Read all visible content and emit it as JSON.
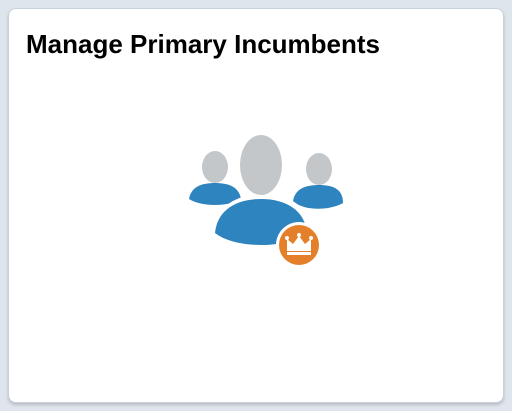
{
  "tile": {
    "title": "Manage Primary Incumbents",
    "icon": "people-group-crown-icon"
  },
  "colors": {
    "head_gray": "#c3c7ca",
    "body_blue": "#2e84be",
    "badge_orange": "#e4802a",
    "crown_white": "#ffffff"
  }
}
